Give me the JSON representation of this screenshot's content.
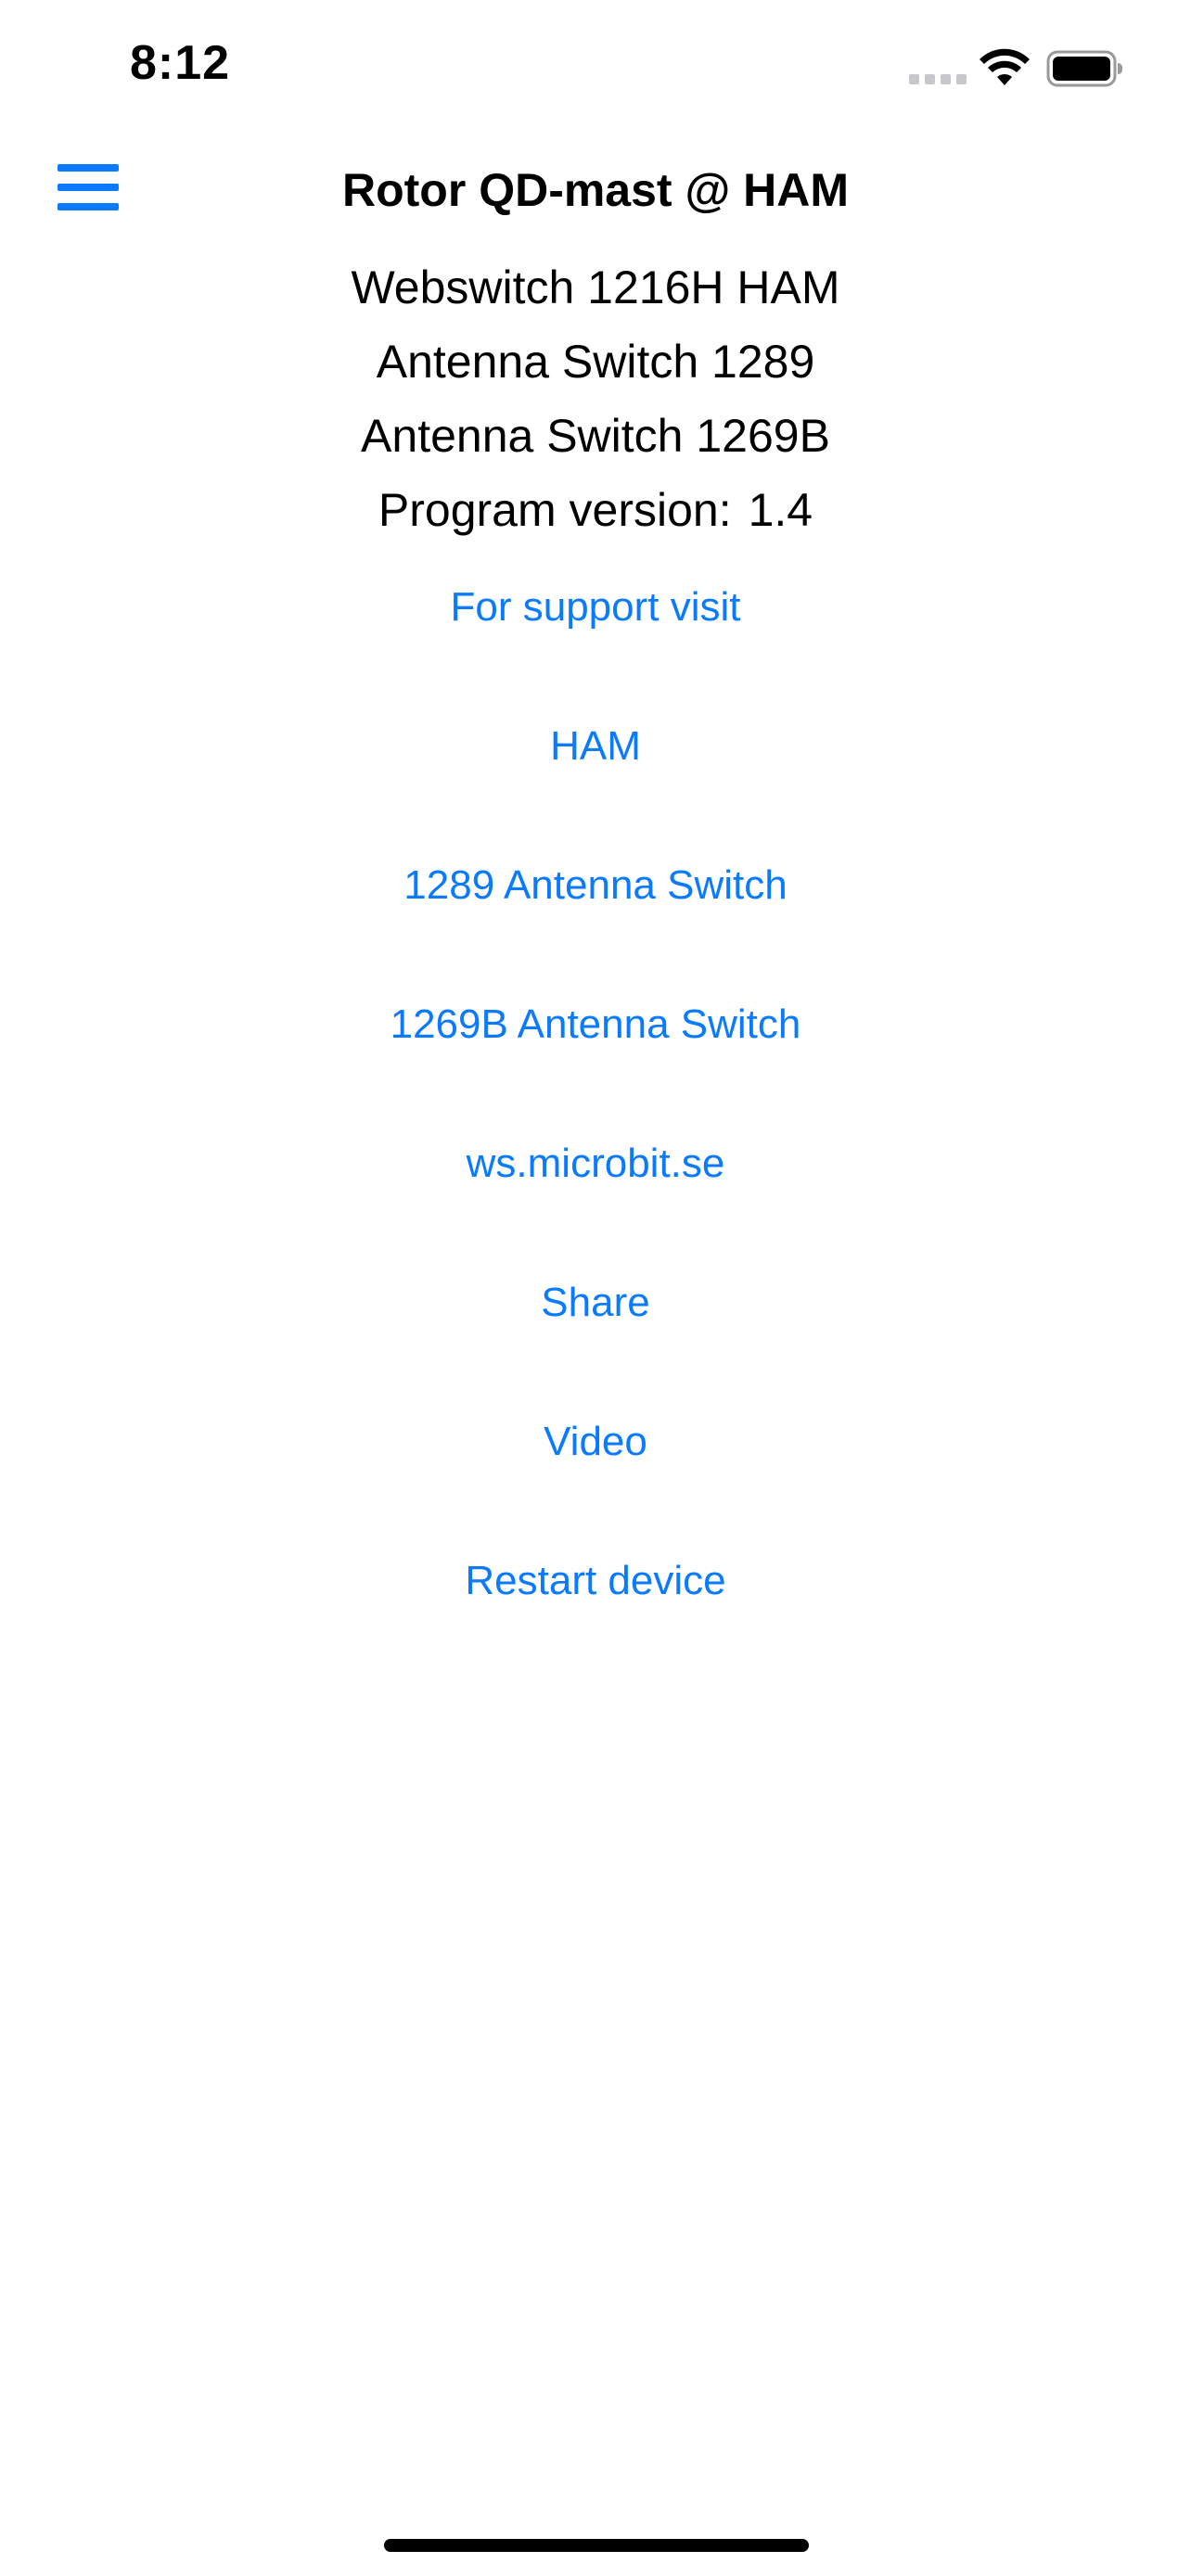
{
  "status_bar": {
    "time": "8:12",
    "icons": [
      "cellular-signal-icon",
      "wifi-icon",
      "battery-icon"
    ]
  },
  "nav": {
    "title": "Rotor QD-mast @ HAM",
    "menu_icon": "hamburger-menu-icon"
  },
  "info": {
    "webswitch": "Webswitch 1216H HAM",
    "switch_1289": "Antenna Switch 1289",
    "switch_1269b": "Antenna Switch 1269B",
    "version_label": "Program version:",
    "version_value": "1.4"
  },
  "links": {
    "support": "For support visit",
    "ham": "HAM",
    "switch_1289": "1289 Antenna Switch",
    "switch_1269b": "1269B Antenna Switch",
    "website": "ws.microbit.se",
    "share": "Share",
    "video": "Video",
    "restart": "Restart device"
  },
  "colors": {
    "accent": "#0a7aff",
    "text": "#000000",
    "background": "#ffffff",
    "signal_inactive": "#c7c7cc"
  }
}
